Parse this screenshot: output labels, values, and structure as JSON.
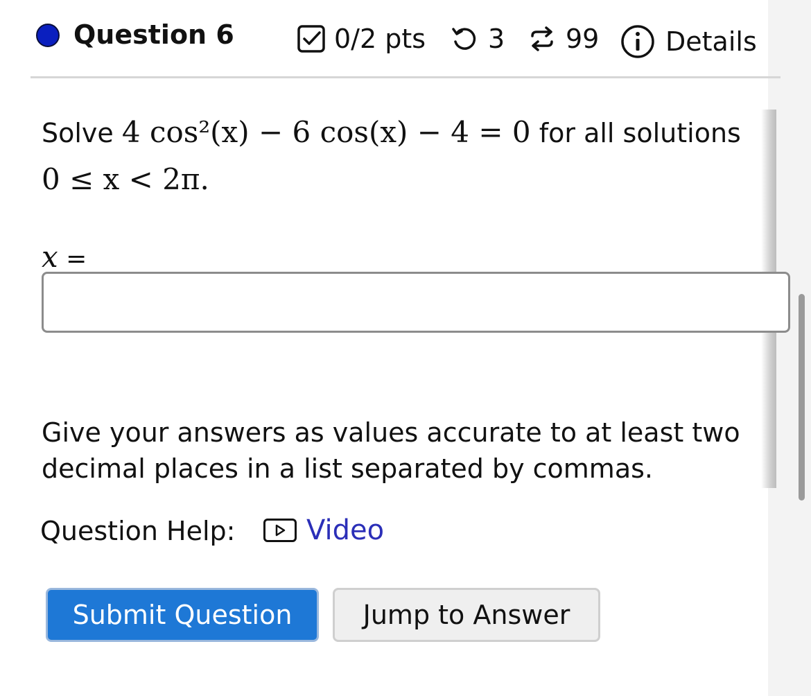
{
  "question": {
    "title": "Question 6",
    "points": "0/2 pts",
    "attempts": "3",
    "regens": "99",
    "details_label": "Details"
  },
  "prompt": {
    "lead": "Solve",
    "equation": "4 cos²(x) − 6 cos(x) − 4 = 0",
    "tail": "for all solutions",
    "domain": "0 ≤ x < 2π."
  },
  "answer": {
    "label_var": "x",
    "label_eq": "=",
    "value": "",
    "placeholder": ""
  },
  "instructions": "Give your answers as values accurate to at least two decimal places in a list separated by commas.",
  "help": {
    "label": "Question Help:",
    "video_label": "Video"
  },
  "buttons": {
    "submit": "Submit Question",
    "jump": "Jump to Answer"
  },
  "colors": {
    "status_dot": "#0a1fbf",
    "submit_bg": "#1e78d6",
    "link": "#2b2fb8"
  },
  "icons": [
    "check-square-icon",
    "retry-icon",
    "regenerate-icon",
    "info-icon",
    "video-play-icon"
  ]
}
